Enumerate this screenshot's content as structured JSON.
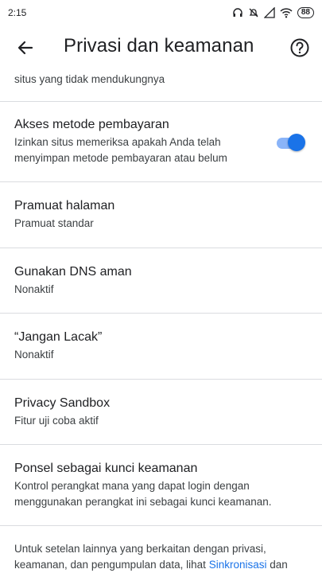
{
  "status_bar": {
    "time": "2:15",
    "battery": "88"
  },
  "app_bar": {
    "title": "Privasi dan keamanan"
  },
  "partial_item": {
    "subtitle": "situs yang tidak mendukungnya"
  },
  "settings": [
    {
      "title": "Akses metode pembayaran",
      "subtitle": "Izinkan situs memeriksa apakah Anda telah menyimpan metode pembayaran atau belum",
      "toggle_on": true
    },
    {
      "title": "Pramuat halaman",
      "subtitle": "Pramuat standar"
    },
    {
      "title": "Gunakan DNS aman",
      "subtitle": "Nonaktif"
    },
    {
      "title": "“Jangan Lacak”",
      "subtitle": "Nonaktif"
    },
    {
      "title": "Privacy Sandbox",
      "subtitle": "Fitur uji coba aktif"
    },
    {
      "title": "Ponsel sebagai kunci keamanan",
      "subtitle": "Kontrol perangkat mana yang dapat login dengan menggunakan perangkat ini sebagai kunci keamanan."
    }
  ],
  "footer": {
    "text": "Untuk setelan lainnya yang berkaitan dengan privasi, keamanan, dan pengumpulan data, lihat",
    "link": "Sinkronisasi",
    "suffix": "dan"
  },
  "colors": {
    "accent": "#1a73e8",
    "toggle_track": "#8ab4f8",
    "divider": "#dadce0"
  },
  "icons": {
    "back": "arrow-back-icon",
    "help": "help-circle-icon"
  }
}
